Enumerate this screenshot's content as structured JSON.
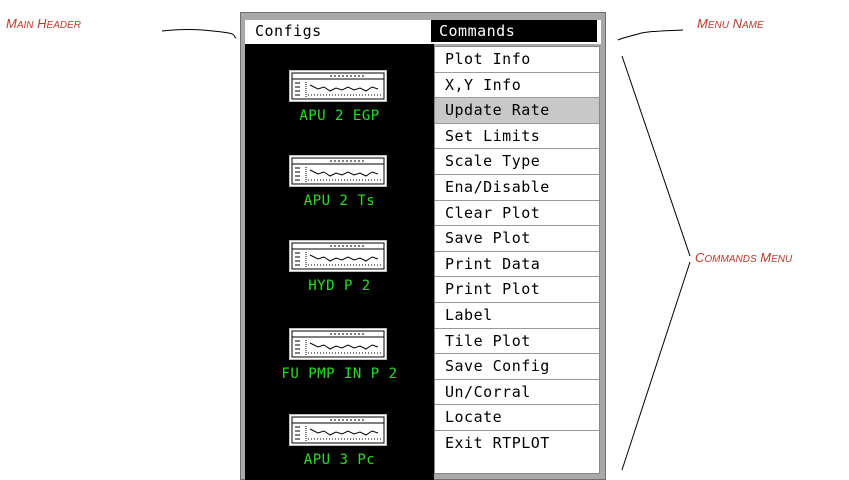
{
  "callouts": {
    "main_header": {
      "first": "M",
      "first_rest": "AIN",
      "second": "H",
      "second_rest": "EADER"
    },
    "menu_name": {
      "first": "M",
      "first_rest": "ENU",
      "second": "N",
      "second_rest": "AME"
    },
    "commands_menu": {
      "first": "C",
      "first_rest": "OMMANDS",
      "second": "M",
      "second_rest": "ENU"
    }
  },
  "menubar": {
    "left": "Configs",
    "right": "Commands"
  },
  "configs": [
    {
      "label": "APU 2 EGP"
    },
    {
      "label": "APU 2 Ts"
    },
    {
      "label": "HYD P 2"
    },
    {
      "label": "FU PMP IN P 2"
    },
    {
      "label": "APU 3 Pc"
    }
  ],
  "commands": [
    {
      "label": "Plot Info"
    },
    {
      "label": "X,Y Info"
    },
    {
      "label": "Update Rate",
      "highlighted": true
    },
    {
      "label": "Set Limits"
    },
    {
      "label": "Scale Type"
    },
    {
      "label": "Ena/Disable"
    },
    {
      "label": "Clear Plot"
    },
    {
      "label": "Save Plot"
    },
    {
      "label": "Print Data"
    },
    {
      "label": "Print Plot"
    },
    {
      "label": "Label"
    },
    {
      "label": "Tile Plot"
    },
    {
      "label": "Save Config"
    },
    {
      "label": "Un/Corral"
    },
    {
      "label": "Locate"
    },
    {
      "label": "Exit RTPLOT"
    }
  ],
  "colors": {
    "callout": "#c0392b",
    "config_label": "#22e022",
    "highlight": "#c8c8c8"
  }
}
